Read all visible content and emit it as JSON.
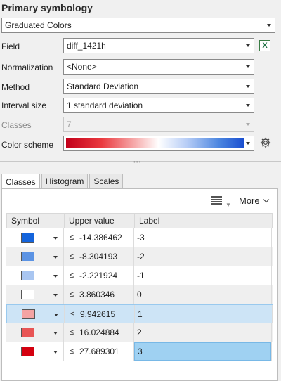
{
  "primary_symbology": {
    "title": "Primary symbology",
    "method_value": "Graduated Colors"
  },
  "fields": {
    "field": {
      "label": "Field",
      "value": "diff_1421h"
    },
    "normalization": {
      "label": "Normalization",
      "value": "<None>"
    },
    "method": {
      "label": "Method",
      "value": "Standard Deviation"
    },
    "interval": {
      "label": "Interval size",
      "value": "1 standard deviation"
    },
    "classes": {
      "label": "Classes",
      "value": "7"
    },
    "color_scheme": {
      "label": "Color scheme",
      "colors": [
        "#c2001a",
        "#ea3a3f",
        "#f7b3b3",
        "#ffffff",
        "#b7cdf6",
        "#4c86e0",
        "#1a4fd0"
      ]
    }
  },
  "icons": {
    "excel_glyph": "X",
    "splitter_dots": "•••"
  },
  "tabs": [
    {
      "label": "Classes"
    },
    {
      "label": "Histogram"
    },
    {
      "label": "Scales"
    }
  ],
  "toolbar": {
    "more_label": "More"
  },
  "table": {
    "headers": {
      "symbol": "Symbol",
      "upper": "Upper value",
      "label": "Label"
    },
    "le": "≤",
    "rows": [
      {
        "color": "#1464dc",
        "upper": "-14.386462",
        "label": "-3"
      },
      {
        "color": "#5b93e4",
        "upper": "-8.304193",
        "label": "-2"
      },
      {
        "color": "#a9c6f1",
        "upper": "-2.221924",
        "label": "-1"
      },
      {
        "color": "#ffffff",
        "upper": "3.860346",
        "label": "0"
      },
      {
        "color": "#f4a3a3",
        "upper": "9.942615",
        "label": "1"
      },
      {
        "color": "#e85555",
        "upper": "16.024884",
        "label": "2"
      },
      {
        "color": "#d4000f",
        "upper": "27.689301",
        "label": "3"
      }
    ]
  }
}
